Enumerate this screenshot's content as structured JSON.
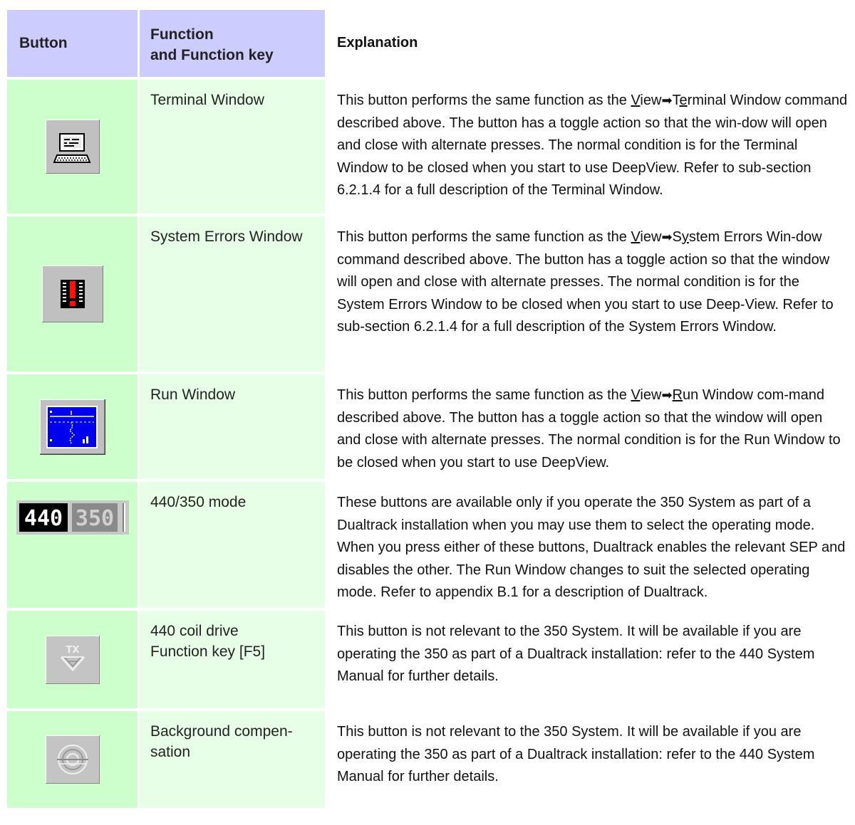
{
  "header": {
    "col1": "Button",
    "col2_line1": "Function",
    "col2_line2": "and Function key",
    "col3": "Explanation"
  },
  "rows": [
    {
      "icon": "terminal-window-icon",
      "function": "Terminal Window",
      "explanation": {
        "pre": "This button performs the same function as the ",
        "menu_u": "V",
        "menu_rest": "iew",
        "arrow": "➡",
        "cmd_a": "T",
        "cmd_u": "e",
        "cmd_rest": "rminal Window",
        "post": " command described above. The button has a toggle action so that the win-dow will open and close with alternate presses. The normal condition is for the Terminal Window to be closed when you start to use DeepView. Refer to sub-section 6.2.1.4 for a full description of the Terminal Window."
      }
    },
    {
      "icon": "system-errors-icon",
      "function": "System Errors Window",
      "explanation": {
        "pre": "This button performs the same function as the ",
        "menu_u": "V",
        "menu_rest": "iew",
        "arrow": "➡",
        "cmd_a": "S",
        "cmd_u": "y",
        "cmd_rest": "stem Errors Win-",
        "post": "dow command described above. The button has a toggle action so that the window will open and close with alternate presses. The normal condition is for the System Errors Window to be closed when you start to use Deep-View. Refer to sub-section 6.2.1.4 for a full description of the System Errors Window."
      }
    },
    {
      "icon": "run-window-icon",
      "function": "Run Window",
      "explanation": {
        "pre": "This button performs the same function as the ",
        "menu_u": "V",
        "menu_rest": "iew",
        "arrow": "➡",
        "cmd_a": "",
        "cmd_u": "R",
        "cmd_rest": "un Window com-",
        "post": "mand described above. The button has a toggle action so that the window will open and close with alternate presses. The normal condition is for the Run Window to be closed when you start to use DeepView."
      }
    },
    {
      "icon": "mode-440-350-icon",
      "icon_labels": [
        "440",
        "350"
      ],
      "function": "440/350 mode",
      "explanation_text": "These buttons are available only if you operate the 350 System as part of a Dualtrack installation when you may use them to select the operating mode. When you press either of these buttons, Dualtrack enables the relevant SEP and disables the other. The Run Window changes to suit the selected operating mode. Refer to appendix B.1 for a description of Dualtrack."
    },
    {
      "icon": "coil-drive-icon",
      "icon_label": "TX",
      "function_line1": "440 coil drive",
      "function_line2": "Function key [F5]",
      "explanation_text": "This button is not relevant to the 350 System. It will be available if you are operating the 350 as part of a Dualtrack installation: refer to the 440 System Manual for further details."
    },
    {
      "icon": "background-compensation-icon",
      "function_line1": "Background compen-",
      "function_line2": "sation",
      "explanation_text": "This button is not relevant to the 350 System. It will be available if you are operating the 350 as part of a Dualtrack installation: refer to the 440 System Manual for further details."
    }
  ]
}
